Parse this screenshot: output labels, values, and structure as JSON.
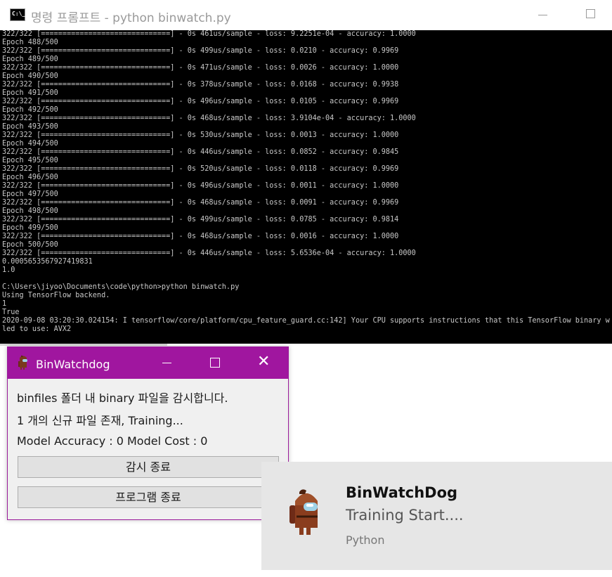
{
  "console": {
    "title": "명령 프롬프트 - python  binwatch.py",
    "icon_text": "C:\\_",
    "lines": [
      "322/322 [==============================] - 0s 461us/sample - loss: 9.2251e-04 - accuracy: 1.0000",
      "Epoch 488/500",
      "322/322 [==============================] - 0s 499us/sample - loss: 0.0210 - accuracy: 0.9969",
      "Epoch 489/500",
      "322/322 [==============================] - 0s 471us/sample - loss: 0.0026 - accuracy: 1.0000",
      "Epoch 490/500",
      "322/322 [==============================] - 0s 378us/sample - loss: 0.0168 - accuracy: 0.9938",
      "Epoch 491/500",
      "322/322 [==============================] - 0s 496us/sample - loss: 0.0105 - accuracy: 0.9969",
      "Epoch 492/500",
      "322/322 [==============================] - 0s 468us/sample - loss: 3.9104e-04 - accuracy: 1.0000",
      "Epoch 493/500",
      "322/322 [==============================] - 0s 530us/sample - loss: 0.0013 - accuracy: 1.0000",
      "Epoch 494/500",
      "322/322 [==============================] - 0s 446us/sample - loss: 0.0852 - accuracy: 0.9845",
      "Epoch 495/500",
      "322/322 [==============================] - 0s 520us/sample - loss: 0.0118 - accuracy: 0.9969",
      "Epoch 496/500",
      "322/322 [==============================] - 0s 496us/sample - loss: 0.0011 - accuracy: 1.0000",
      "Epoch 497/500",
      "322/322 [==============================] - 0s 468us/sample - loss: 0.0091 - accuracy: 0.9969",
      "Epoch 498/500",
      "322/322 [==============================] - 0s 499us/sample - loss: 0.0785 - accuracy: 0.9814",
      "Epoch 499/500",
      "322/322 [==============================] - 0s 468us/sample - loss: 0.0016 - accuracy: 1.0000",
      "Epoch 500/500",
      "322/322 [==============================] - 0s 446us/sample - loss: 5.6536e-04 - accuracy: 1.0000",
      "0.0005653567927419831",
      "1.0",
      "",
      "C:\\Users\\jiyoo\\Documents\\code\\python>python binwatch.py",
      "Using TensorFlow backend.",
      "1",
      "True",
      "2020-09-08 03:20:30.024154: I tensorflow/core/platform/cpu_feature_guard.cc:142] Your CPU supports instructions that this TensorFlow binary was n",
      "led to use: AVX2"
    ]
  },
  "binwatchdog": {
    "title": "BinWatchdog",
    "status_line": "binfiles 폴더 내 binary 파일을 감시합니다.",
    "files_line": "1 개의 신규 파일 존재, Training...",
    "metrics_line": "Model Accuracy : 0 Model Cost : 0",
    "stop_watch_label": "감시 종료",
    "exit_program_label": "프로그램 종료",
    "accent_color": "#a0169f"
  },
  "toast": {
    "title": "BinWatchDog",
    "message": "Training Start....",
    "app_name": "Python"
  },
  "icons": {
    "console_app": "command-prompt-icon",
    "binwatchdog_app": "among-us-crewmate-icon",
    "toast_app": "among-us-crewmate-icon"
  }
}
